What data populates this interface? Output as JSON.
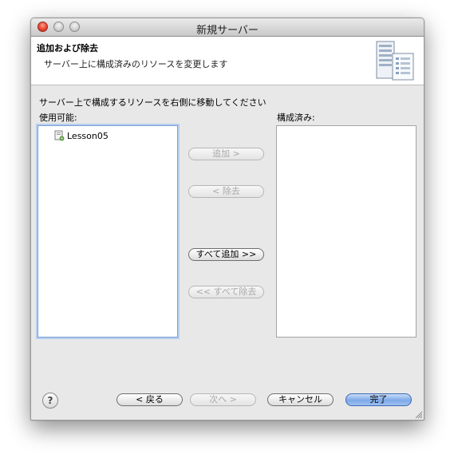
{
  "window": {
    "title": "新規サーバー"
  },
  "header": {
    "title": "追加および除去",
    "description": "サーバー上に構成済みのリソースを変更します",
    "icon": "server-icon"
  },
  "main": {
    "instruction": "サーバー上で構成するリソースを右側に移動してください",
    "available_label": "使用可能:",
    "configured_label": "構成済み:",
    "available_items": [
      {
        "label": "Lesson05",
        "icon": "project-icon"
      }
    ],
    "configured_items": []
  },
  "transfer_buttons": {
    "add": "追加 >",
    "remove": "< 除去",
    "add_all": "すべて追加 >>",
    "remove_all": "<< すべて除去"
  },
  "footer": {
    "help": "?",
    "back": "< 戻る",
    "next": "次へ >",
    "cancel": "キャンセル",
    "finish": "完了"
  }
}
